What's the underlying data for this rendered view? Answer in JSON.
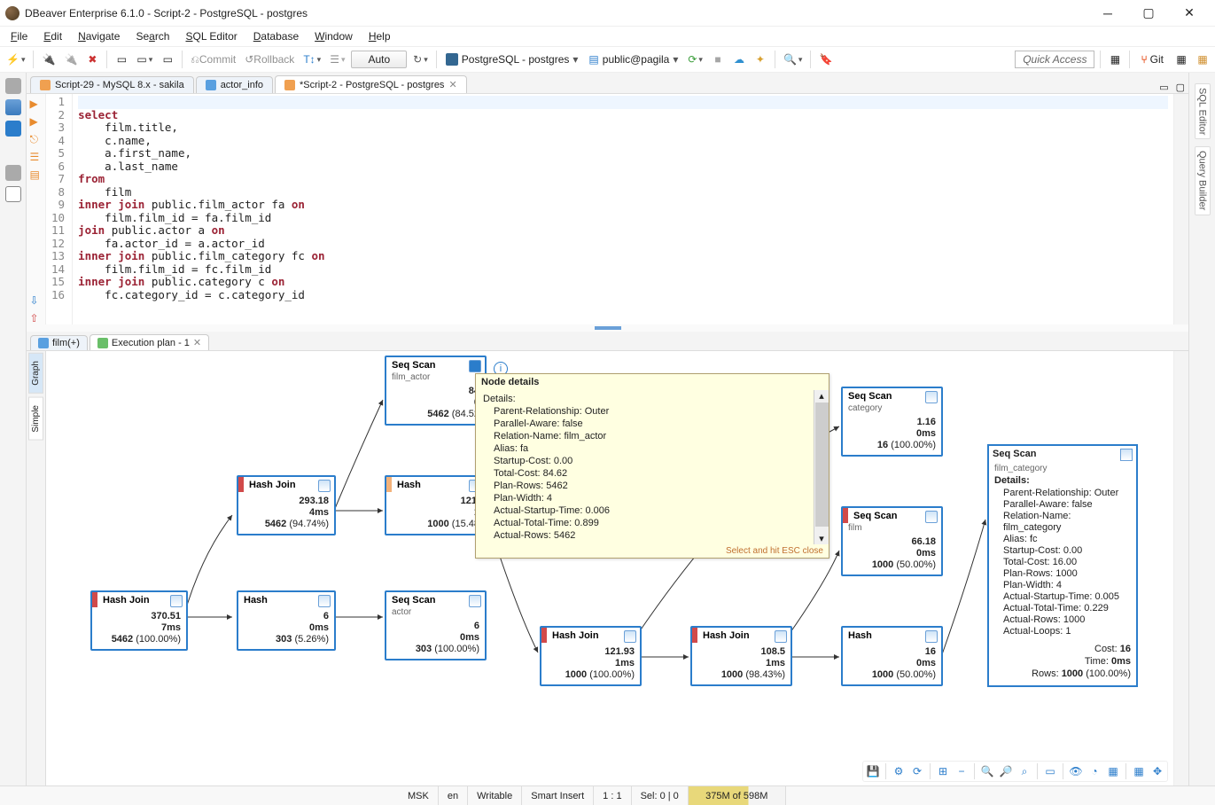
{
  "window": {
    "title": "DBeaver Enterprise 6.1.0 - Script-2 - PostgreSQL - postgres"
  },
  "menu": {
    "file": "File",
    "edit": "Edit",
    "navigate": "Navigate",
    "search": "Search",
    "sql_editor": "SQL Editor",
    "database": "Database",
    "window": "Window",
    "help": "Help"
  },
  "toolbar": {
    "commit": "Commit",
    "rollback": "Rollback",
    "auto": "Auto",
    "connection": "PostgreSQL - postgres",
    "schema": "public@pagila",
    "quick_access": "Quick Access",
    "git": "Git"
  },
  "editor_tabs": [
    {
      "label": "Script-29 - MySQL 8.x - sakila",
      "active": false
    },
    {
      "label": "actor_info",
      "active": false
    },
    {
      "label": "*Script-2 - PostgreSQL - postgres",
      "active": true
    }
  ],
  "sql": {
    "lines": [
      "",
      "select",
      "    film.title,",
      "    c.name,",
      "    a.first_name,",
      "    a.last_name",
      "from",
      "    film",
      "inner join public.film_actor fa on",
      "    film.film_id = fa.film_id",
      "join public.actor a on",
      "    fa.actor_id = a.actor_id",
      "inner join public.film_category fc on",
      "    film.film_id = fc.film_id",
      "inner join public.category c on",
      "    fc.category_id = c.category_id"
    ]
  },
  "result_tabs": [
    {
      "label": "film(+)",
      "active": false
    },
    {
      "label": "Execution plan - 1",
      "active": true
    }
  ],
  "side_tabs": {
    "graph": "Graph",
    "simple": "Simple"
  },
  "right_tabs": {
    "sql_editor": "SQL Editor",
    "query_builder": "Query Builder"
  },
  "plan_nodes": {
    "n1": {
      "title": "Hash Join",
      "cost": "370.51",
      "time": "7ms",
      "rows": "5462",
      "pct": "(100.00%)",
      "bar": "#d14a4a"
    },
    "n2": {
      "title": "Hash Join",
      "cost": "293.18",
      "time": "4ms",
      "rows": "5462",
      "pct": "(94.74%)",
      "bar": "#d14a4a"
    },
    "n3": {
      "title": "Hash",
      "cost": "6",
      "time": "0ms",
      "rows": "303",
      "pct": "(5.26%)",
      "bar": ""
    },
    "n4": {
      "title": "Seq Scan",
      "sub": "film_actor",
      "cost": "84",
      "time": "0",
      "rows": "5462",
      "pct": "(84.52",
      "bar": ""
    },
    "n5": {
      "title": "Hash",
      "cost": "121.",
      "time": "1",
      "rows": "1000",
      "pct": "(15.48",
      "bar": "#f3b27a"
    },
    "n6": {
      "title": "Seq Scan",
      "sub": "actor",
      "cost": "6",
      "time": "0ms",
      "rows": "303",
      "pct": "(100.00%)",
      "bar": ""
    },
    "n7": {
      "title": "Hash Join",
      "cost": "121.93",
      "time": "1ms",
      "rows": "1000",
      "pct": "(100.00%)",
      "bar": "#d14a4a"
    },
    "n8": {
      "title": "Hash Join",
      "cost": "108.5",
      "time": "1ms",
      "rows": "1000",
      "pct": "(98.43%)",
      "bar": "#d14a4a"
    },
    "n9": {
      "title": "Hash",
      "cost": "16",
      "time": "0ms",
      "rows": "1000",
      "pct": "(50.00%)",
      "bar": ""
    },
    "n10": {
      "title": "Seq Scan",
      "sub": "category",
      "cost": "1.16",
      "time": "0ms",
      "rows": "16",
      "pct": "(100.00%)",
      "bar": ""
    },
    "n11": {
      "title": "Seq Scan",
      "sub": "film",
      "cost": "66.18",
      "time": "0ms",
      "rows": "1000",
      "pct": "(50.00%)",
      "bar": "#d14a4a"
    }
  },
  "tooltip": {
    "header": "Node details",
    "details_label": "Details:",
    "rows": [
      "Parent-Relationship: Outer",
      "Parallel-Aware: false",
      "Relation-Name: film_actor",
      "Alias: fa",
      "Startup-Cost: 0.00",
      "Total-Cost: 84.62",
      "Plan-Rows: 5462",
      "Plan-Width: 4",
      "Actual-Startup-Time: 0.006",
      "Actual-Total-Time: 0.899",
      "Actual-Rows: 5462"
    ],
    "footer": "Select and hit ESC close"
  },
  "detail_panel": {
    "header_title": "Seq Scan",
    "header_sub": "film_category",
    "details_label": "Details:",
    "rows": [
      "Parent-Relationship: Outer",
      "Parallel-Aware: false",
      "Relation-Name: film_category",
      "Alias: fc",
      "Startup-Cost: 0.00",
      "Total-Cost: 16.00",
      "Plan-Rows: 1000",
      "Plan-Width: 4",
      "Actual-Startup-Time: 0.005",
      "Actual-Total-Time: 0.229",
      "Actual-Rows: 1000",
      "Actual-Loops: 1"
    ],
    "bottom": {
      "cost_l": "Cost:",
      "cost_v": "16",
      "time_l": "Time:",
      "time_v": "0ms",
      "rows_l": "Rows:",
      "rows_v": "1000",
      "rows_pct": "(100.00%)"
    }
  },
  "status": {
    "msk": "MSK",
    "en": "en",
    "writable": "Writable",
    "insert": "Smart Insert",
    "line": "1 : 1",
    "sel": "Sel: 0 | 0",
    "heap": "375M of 598M"
  }
}
